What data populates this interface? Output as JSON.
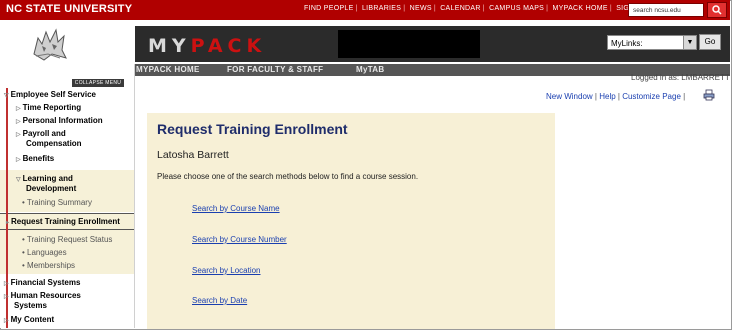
{
  "topbar": {
    "brand": "NC STATE UNIVERSITY",
    "links": [
      "FIND PEOPLE",
      "LIBRARIES",
      "NEWS",
      "CALENDAR",
      "CAMPUS MAPS",
      "MYPACK HOME",
      "SIGN OUT"
    ],
    "search_value": "search ncsu.edu",
    "search_icon": "search-icon",
    "accent": "#b00000"
  },
  "header": {
    "logo_letters_a": "MY",
    "logo_letters_b": "PACK",
    "mylinks_value": "MyLinks:",
    "go_label": "Go"
  },
  "tabs": [
    "MYPACK HOME",
    "FOR FACULTY & STAFF",
    "MyTAB"
  ],
  "user": {
    "logged_in": "Logged in as: LMBARRETT"
  },
  "toolbar": {
    "new_window": "New Window",
    "help": "Help",
    "customize": "Customize Page"
  },
  "sidebar": {
    "collapse_label": "COLLAPSE MENU",
    "section_title": "Employee Self Service",
    "items": {
      "time": "Time Reporting",
      "personal": "Personal Information",
      "payroll_1": "Payroll and",
      "payroll_2": "Compensation",
      "benefits": "Benefits",
      "learning_1": "Learning and",
      "learning_2": "Development",
      "training_summary": "Training Summary",
      "request_training": "Request Training Enrollment",
      "training_status": "Training Request Status",
      "languages": "Languages",
      "memberships": "Memberships",
      "financial": "Financial Systems",
      "hr_1": "Human Resources",
      "hr_2": "Systems",
      "my_content": "My Content"
    }
  },
  "main": {
    "title": "Request Training Enrollment",
    "person": "Latosha Barrett",
    "instructions": "Please choose one of the search methods below to find a course session.",
    "links": [
      "Search by Course Name",
      "Search by Course Number",
      "Search by Location",
      "Search by Date"
    ]
  }
}
